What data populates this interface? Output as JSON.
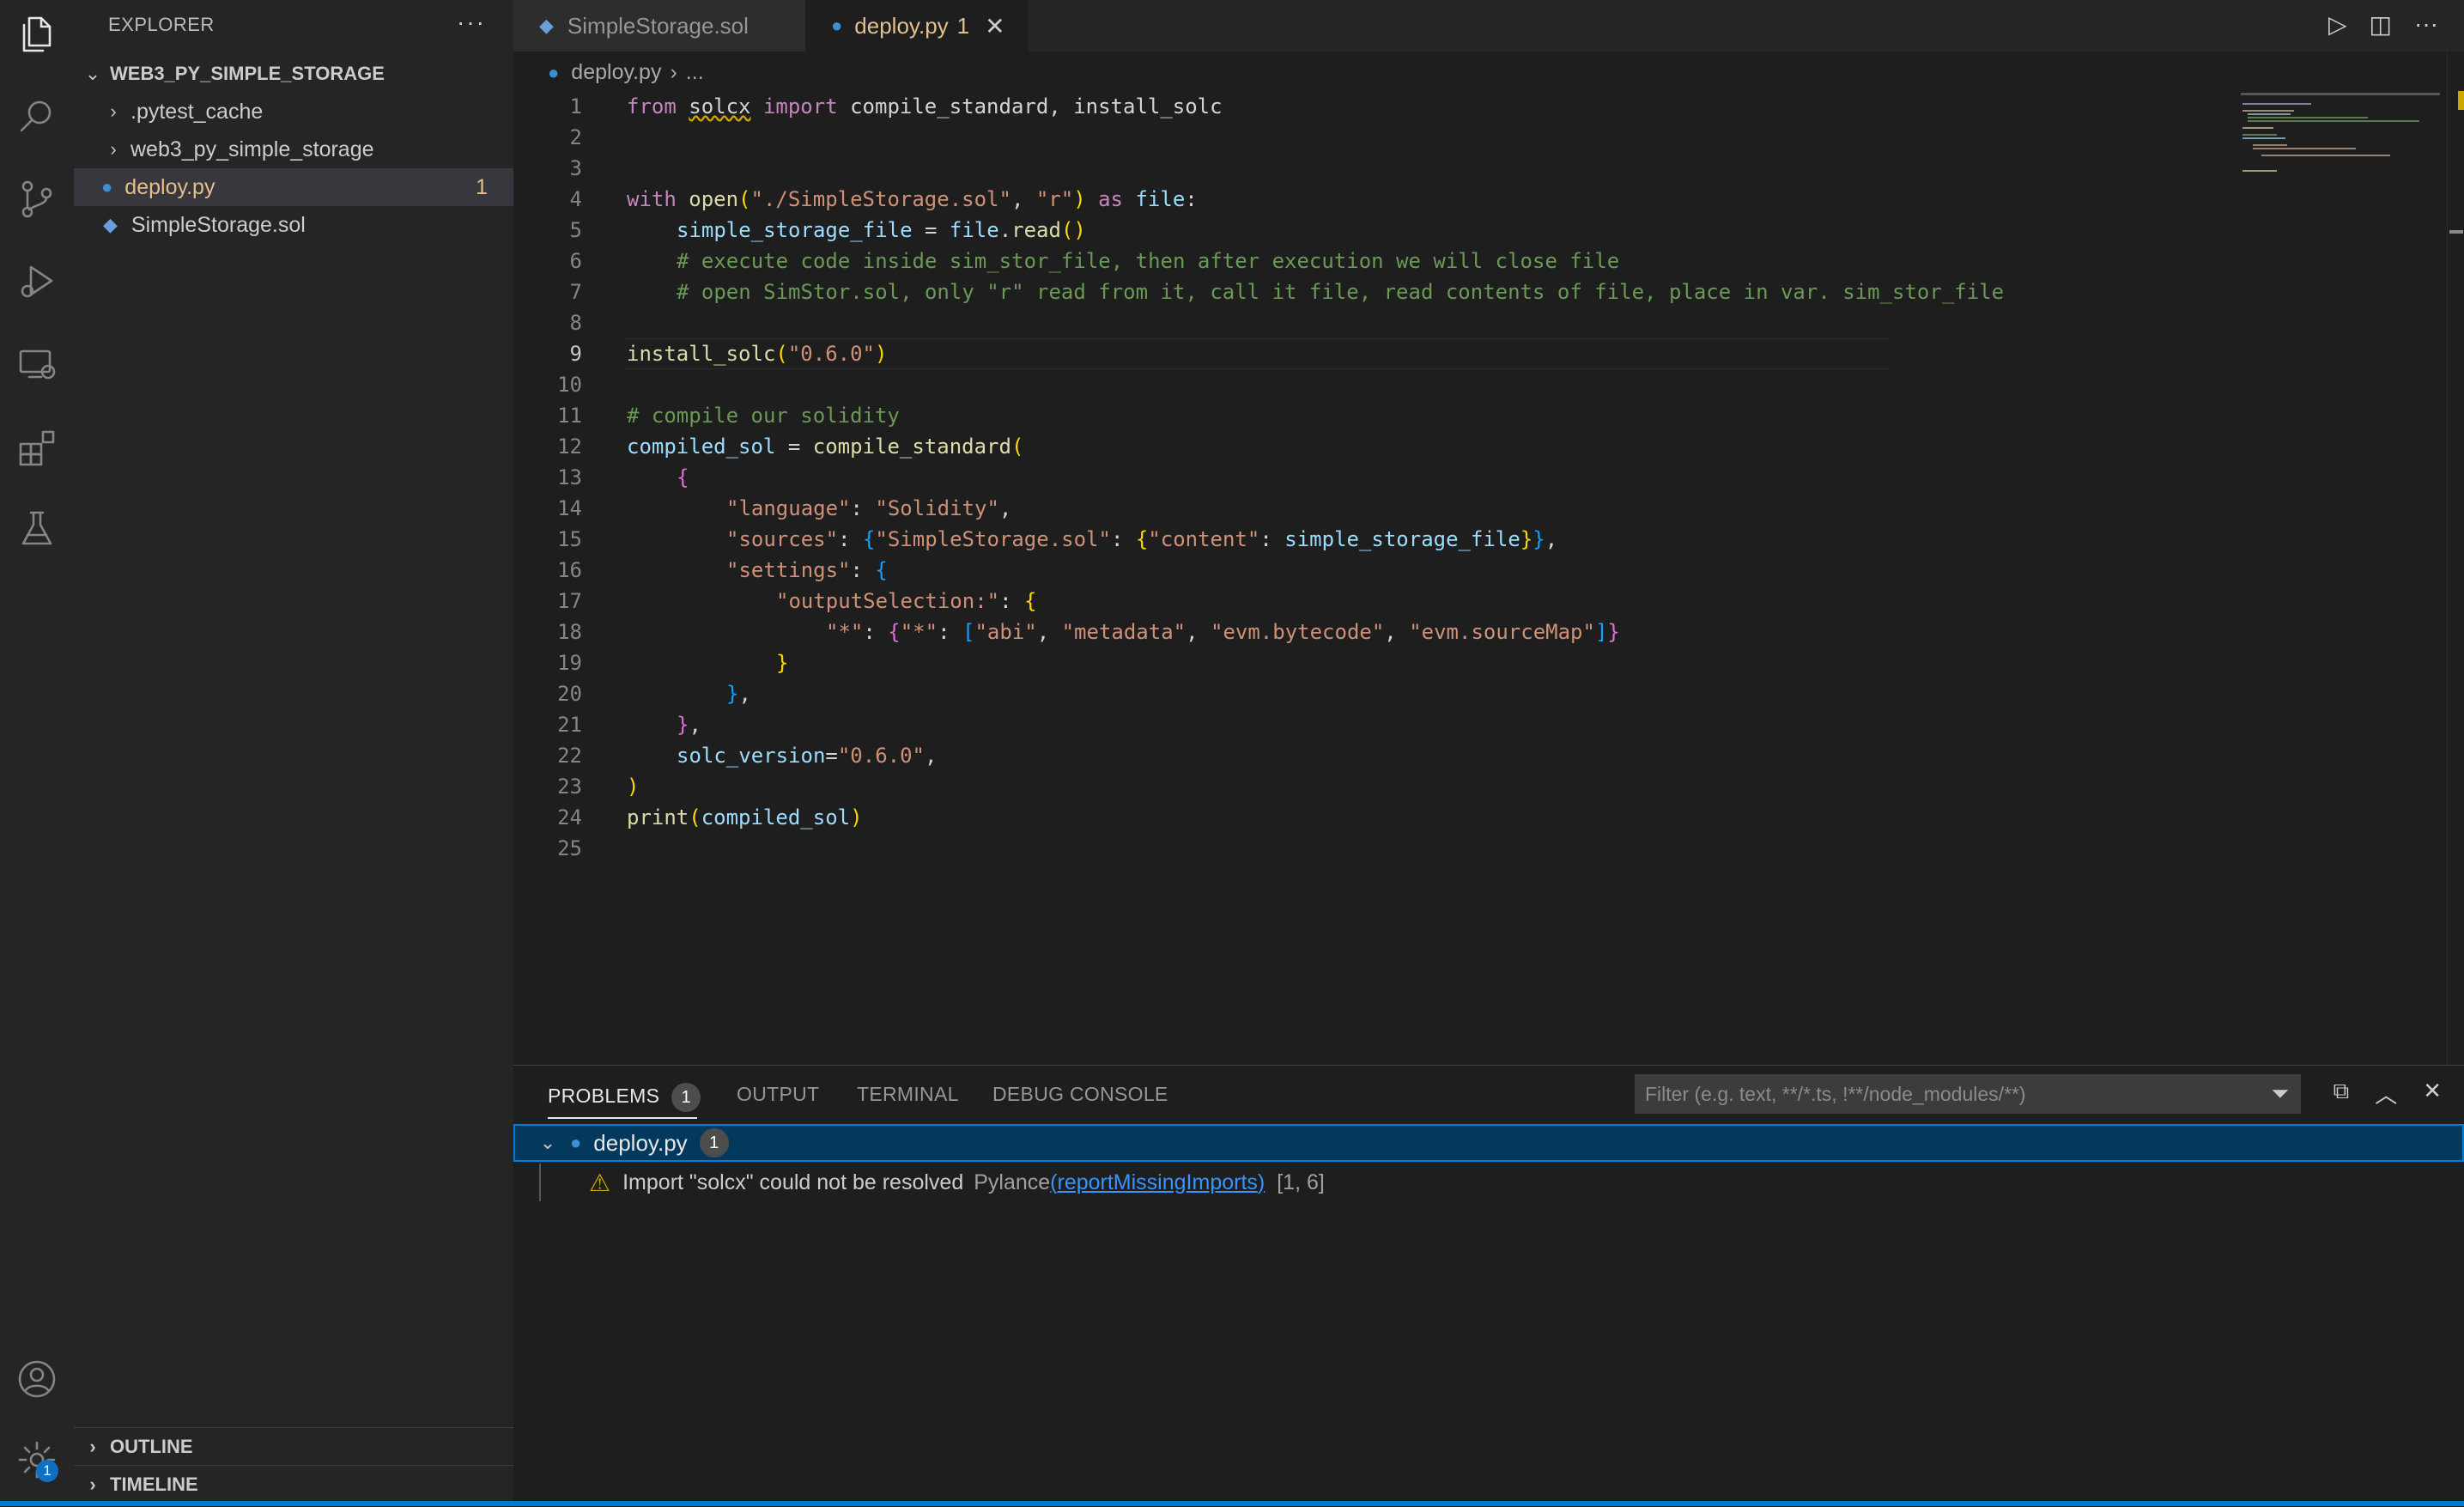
{
  "sidebar": {
    "header": "EXPLORER",
    "more": "···",
    "project": "WEB3_PY_SIMPLE_STORAGE",
    "items": [
      {
        "label": ".pytest_cache"
      },
      {
        "label": "web3_py_simple_storage"
      },
      {
        "label": "deploy.py",
        "badge": "1"
      },
      {
        "label": "SimpleStorage.sol"
      }
    ],
    "outline": "OUTLINE",
    "timeline": "TIMELINE"
  },
  "activity": {
    "settings_badge": "1"
  },
  "tabs": [
    {
      "label": "SimpleStorage.sol"
    },
    {
      "label": "deploy.py",
      "badge": "1",
      "close": "✕"
    }
  ],
  "breadcrumb": {
    "file": "deploy.py",
    "sep": "›",
    "rest": "..."
  },
  "editor": {
    "line_numbers": [
      "1",
      "2",
      "3",
      "4",
      "5",
      "6",
      "7",
      "8",
      "9",
      "10",
      "11",
      "12",
      "13",
      "14",
      "15",
      "16",
      "17",
      "18",
      "19",
      "20",
      "21",
      "22",
      "23",
      "24",
      "25"
    ],
    "current_line": "9",
    "code": {
      "l1": {
        "a": "from",
        "b": "solcx",
        "c": "import",
        "d": " compile_standard, install_solc"
      },
      "l4": {
        "a": "with",
        "b": "open",
        "c": "(",
        "d": "\"./SimpleStorage.sol\"",
        "e": ", ",
        "f": "\"r\"",
        "g": ")",
        "h": "as",
        "i": "file",
        "j": ":"
      },
      "l5": {
        "a": "simple_storage_file",
        "b": " = ",
        "c": "file",
        "d": ".",
        "e": "read",
        "f": "()"
      },
      "l6": "# execute code inside sim_stor_file, then after execution we will close file",
      "l7": "# open SimStor.sol, only \"r\" read from it, call it file, read contents of file, place in var. sim_stor_file",
      "l9": {
        "a": "install_solc",
        "b": "(",
        "c": "\"0.6.0\"",
        "d": ")"
      },
      "l11": "# compile our solidity",
      "l12": {
        "a": "compiled_sol",
        "b": " = ",
        "c": "compile_standard",
        "d": "("
      },
      "l13": "{",
      "l14": {
        "a": "\"language\"",
        "b": ": ",
        "c": "\"Solidity\"",
        "d": ","
      },
      "l15": {
        "a": "\"sources\"",
        "b": ": ",
        "c": "{",
        "d": "\"SimpleStorage.sol\"",
        "e": ": ",
        "f": "{",
        "g": "\"content\"",
        "h": ": ",
        "i": "simple_storage_file",
        "j": "}",
        "k": "}",
        "l": ","
      },
      "l16": {
        "a": "\"settings\"",
        "b": ": ",
        "c": "{"
      },
      "l17": {
        "a": "\"outputSelection:\"",
        "b": ": ",
        "c": "{"
      },
      "l18": {
        "a": "\"*\"",
        "b": ": ",
        "c": "{",
        "d": "\"*\"",
        "e": ": ",
        "f": "[",
        "g": "\"abi\"",
        "h": ", ",
        "i": "\"metadata\"",
        "j": ", ",
        "k": "\"evm.bytecode\"",
        "l": ", ",
        "m": "\"evm.sourceMap\"",
        "n": "]",
        "o": "}"
      },
      "l19": "}",
      "l20": {
        "a": "}",
        "b": ","
      },
      "l21": {
        "a": "}",
        "b": ","
      },
      "l22": {
        "a": "solc_version",
        "b": "=",
        "c": "\"0.6.0\"",
        "d": ","
      },
      "l23": ")",
      "l24": {
        "a": "print",
        "b": "(",
        "c": "compiled_sol",
        "d": ")"
      }
    }
  },
  "panel": {
    "tabs": [
      {
        "label": "PROBLEMS",
        "badge": "1"
      },
      {
        "label": "OUTPUT"
      },
      {
        "label": "TERMINAL"
      },
      {
        "label": "DEBUG CONSOLE"
      }
    ],
    "filter_placeholder": "Filter (e.g. text, **/*.ts, !**/node_modules/**)",
    "problem_file": {
      "name": "deploy.py",
      "count": "1"
    },
    "problem": {
      "message": "Import \"solcx\" could not be resolved",
      "source": "Pylance",
      "code_open": "(",
      "code": "reportMissingImports",
      "code_close": ")",
      "position": "[1, 6]"
    }
  }
}
